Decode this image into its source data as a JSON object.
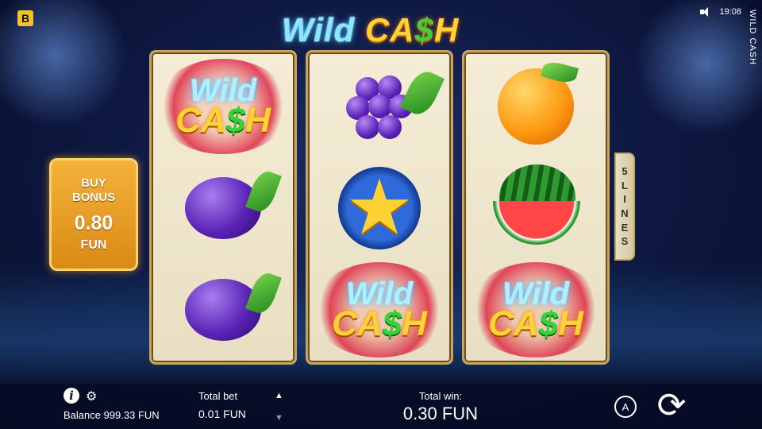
{
  "header": {
    "brand_letter": "B",
    "time": "19:08",
    "side_title": "WILD CASH"
  },
  "title": {
    "wild": "Wild",
    "cash_a": "CA",
    "cash_dollar": "$",
    "cash_h": "H"
  },
  "buy_bonus": {
    "label_line1": "BUY",
    "label_line2": "BONUS",
    "amount": "0.80",
    "currency": "FUN"
  },
  "lines_tab": {
    "chars": [
      "5",
      "L",
      "I",
      "N",
      "E",
      "S"
    ]
  },
  "symbol_text": {
    "wild": "Wild",
    "cash_a": "CA",
    "cash_dollar": "$",
    "cash_h": "H"
  },
  "reels": [
    [
      "wild-cash-symbol",
      "plum-symbol",
      "plum-symbol"
    ],
    [
      "grapes-symbol",
      "star-symbol",
      "wild-cash-symbol"
    ],
    [
      "orange-symbol",
      "watermelon-symbol",
      "wild-cash-symbol"
    ]
  ],
  "footer": {
    "balance": "Balance 999.33 FUN",
    "total_bet_label": "Total bet",
    "total_bet_value": "0.01 FUN",
    "total_win_label": "Total win:",
    "total_win_value": "0.30 FUN",
    "auto_label": "A",
    "up_arrow": "▲",
    "down_arrow": "▼",
    "spin_glyph": "⟳"
  }
}
